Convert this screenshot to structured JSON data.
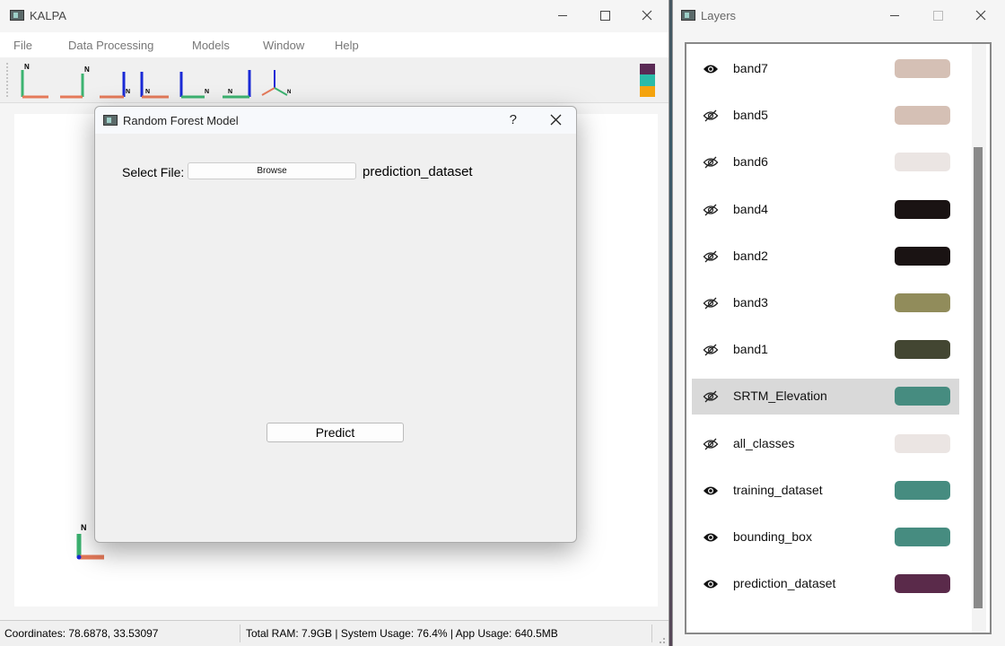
{
  "main_window": {
    "title": "KALPA",
    "menu": [
      "File",
      "Data Processing",
      "Models",
      "Window",
      "Help"
    ],
    "toolbar_tools": [
      "north-up-axis-icon",
      "north-left-axis-icon",
      "north-down-axis-icon",
      "north-arrow-axis-icon",
      "north-right-axis-icon",
      "north-east-axis-icon",
      "isometric-axis-icon"
    ],
    "swatch_colors": [
      "#5a2a55",
      "#2abba8",
      "#f4a30e"
    ],
    "status": {
      "coordinates": "Coordinates: 78.6878, 33.53097",
      "ram": "Total RAM: 7.9GB | System Usage: 76.4% | App Usage: 640.5MB"
    }
  },
  "dialog": {
    "title": "Random Forest Model",
    "help": "?",
    "select_label": "Select File:",
    "browse_label": "Browse",
    "selected_file": "prediction_dataset",
    "predict_label": "Predict"
  },
  "layers_window": {
    "title": "Layers",
    "items": [
      {
        "name": "band7",
        "visible": true,
        "color": "#d5c0b5"
      },
      {
        "name": "band5",
        "visible": false,
        "color": "#d5c0b5"
      },
      {
        "name": "band6",
        "visible": false,
        "color": "#ebe5e3"
      },
      {
        "name": "band4",
        "visible": false,
        "color": "#1a1313"
      },
      {
        "name": "band2",
        "visible": false,
        "color": "#1a1313"
      },
      {
        "name": "band3",
        "visible": false,
        "color": "#918c5b"
      },
      {
        "name": "band1",
        "visible": false,
        "color": "#434632"
      },
      {
        "name": "SRTM_Elevation",
        "visible": false,
        "color": "#468c80",
        "selected": true
      },
      {
        "name": "all_classes",
        "visible": false,
        "color": "#ebe5e3"
      },
      {
        "name": "training_dataset",
        "visible": true,
        "color": "#468c80"
      },
      {
        "name": "bounding_box",
        "visible": true,
        "color": "#468c80"
      },
      {
        "name": "prediction_dataset",
        "visible": true,
        "color": "#5a2a4a"
      }
    ]
  }
}
